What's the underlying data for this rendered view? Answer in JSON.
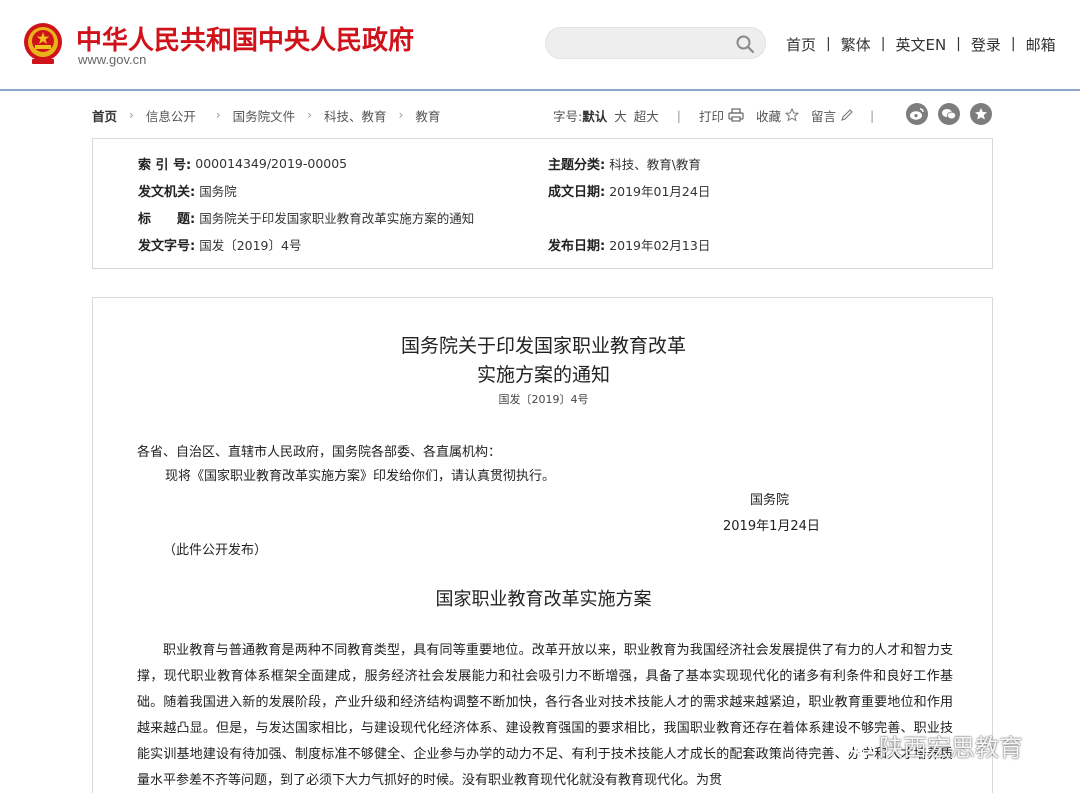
{
  "header": {
    "site_title": "中华人民共和国中央人民政府",
    "site_url": "www.gov.cn",
    "search_placeholder": "",
    "nav": [
      "首页",
      "繁体",
      "英文EN",
      "登录",
      "邮箱"
    ],
    "brand_color": "#d0121b"
  },
  "breadcrumb": {
    "items": [
      "首页",
      "信息公开",
      "国务院文件",
      "科技、教育",
      "教育"
    ]
  },
  "tools": {
    "font_label": "字号:",
    "font_default": "默认",
    "font_large": "大",
    "font_xlarge": "超大",
    "print": "打印",
    "favorite": "收藏",
    "comment": "留言"
  },
  "share_icons": [
    "weibo-icon",
    "wechat-icon",
    "star-icon"
  ],
  "meta": {
    "index_label": "索 引 号:",
    "index_value": "000014349/2019-00005",
    "issuer_label": "发文机关:",
    "issuer_value": "国务院",
    "title_label": "标　　题:",
    "title_value": "国务院关于印发国家职业教育改革实施方案的通知",
    "docno_label": "发文字号:",
    "docno_value": "国发〔2019〕4号",
    "topic_label": "主题分类:",
    "topic_value": "科技、教育\\教育",
    "written_label": "成文日期:",
    "written_value": "2019年01月24日",
    "published_label": "发布日期:",
    "published_value": "2019年02月13日"
  },
  "article": {
    "title_line1": "国务院关于印发国家职业教育改革",
    "title_line2": "实施方案的通知",
    "doc_no": "国发〔2019〕4号",
    "addressee": "各省、自治区、直辖市人民政府，国务院各部委、各直属机构：",
    "instruction": "现将《国家职业教育改革实施方案》印发给你们，请认真贯彻执行。",
    "signer": "国务院",
    "date": "2019年1月24日",
    "public_note": "（此件公开发布）",
    "subtitle": "国家职业教育改革实施方案",
    "body": "职业教育与普通教育是两种不同教育类型，具有同等重要地位。改革开放以来，职业教育为我国经济社会发展提供了有力的人才和智力支撑，现代职业教育体系框架全面建成，服务经济社会发展能力和社会吸引力不断增强，具备了基本实现现代化的诸多有利条件和良好工作基础。随着我国进入新的发展阶段，产业升级和经济结构调整不断加快，各行各业对技术技能人才的需求越来越紧迫，职业教育重要地位和作用越来越凸显。但是，与发达国家相比，与建设现代化经济体系、建设教育强国的要求相比，我国职业教育还存在着体系建设不够完善、职业技能实训基地建设有待加强、制度标准不够健全、企业参与办学的动力不足、有利于技术技能人才成长的配套政策尚待完善、办学和人才培养质量水平参差不齐等问题，到了必须下大力气抓好的时候。没有职业教育现代化就没有教育现代化。为贯"
  },
  "watermark": {
    "text": "陕西宏思教育"
  }
}
